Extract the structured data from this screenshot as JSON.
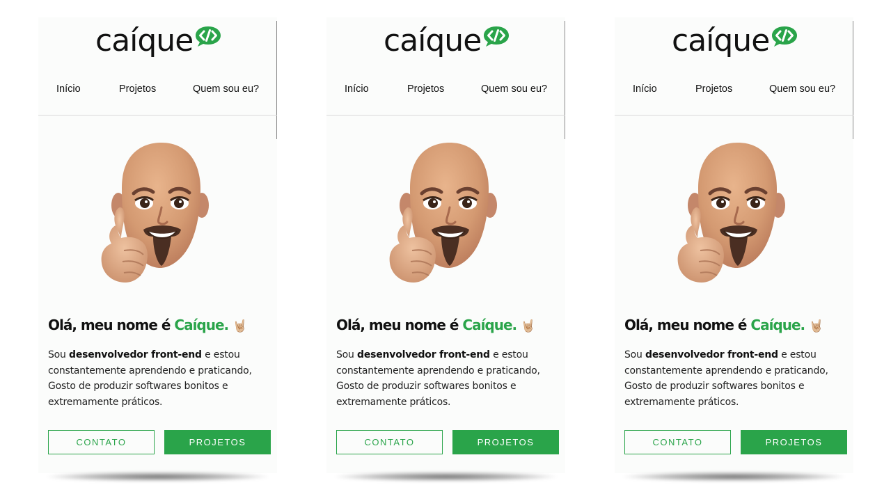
{
  "logo": {
    "text": "caíque",
    "icon": "code-bubble-icon"
  },
  "nav": [
    {
      "label": "Início"
    },
    {
      "label": "Projetos"
    },
    {
      "label": "Quem sou eu?"
    }
  ],
  "avatar": {
    "icon": "memoji-thumbs-up-icon"
  },
  "hero": {
    "greeting": "Olá, meu nome é",
    "name": "Caíque.",
    "emoji": "🤘🏼",
    "desc_prefix": "Sou",
    "desc_bold": "desenvolvedor front-end",
    "desc_rest": "e estou constantemente aprendendo e praticando, Gosto de produzir softwares bonitos e extremamente práticos."
  },
  "buttons": {
    "contact": "CONTATO",
    "projects": "PROJETOS"
  },
  "colors": {
    "accent": "#2aa44a",
    "background": "#fbfcfb",
    "text": "#111111"
  }
}
